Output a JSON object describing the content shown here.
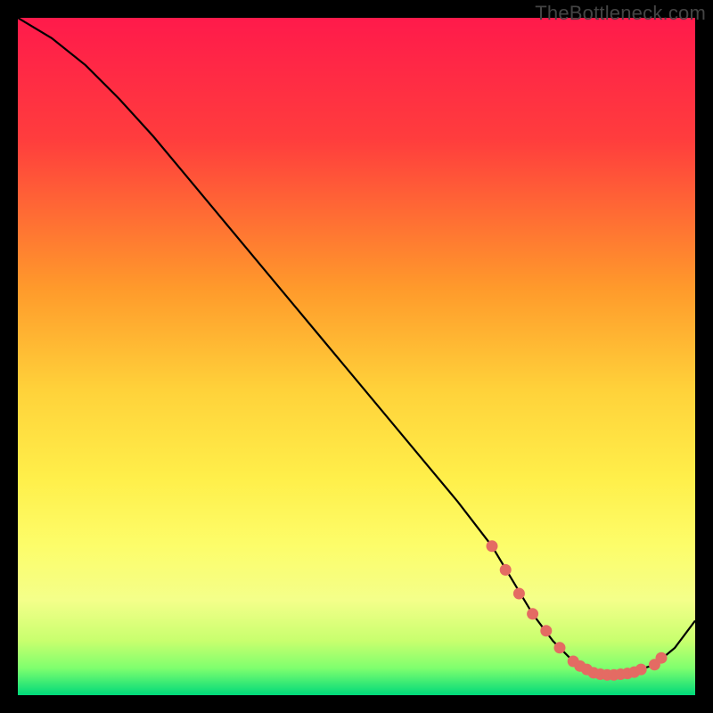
{
  "watermark": "TheBottleneck.com",
  "chart_data": {
    "type": "line",
    "title": "",
    "xlabel": "",
    "ylabel": "",
    "xlim": [
      0,
      100
    ],
    "ylim": [
      0,
      100
    ],
    "grid": false,
    "legend": false,
    "background_gradient": [
      {
        "stop": 0.0,
        "color": "#ff1a4b"
      },
      {
        "stop": 0.18,
        "color": "#ff3d3d"
      },
      {
        "stop": 0.4,
        "color": "#ff9a2b"
      },
      {
        "stop": 0.55,
        "color": "#ffd23a"
      },
      {
        "stop": 0.68,
        "color": "#ffef4a"
      },
      {
        "stop": 0.78,
        "color": "#fdfd6a"
      },
      {
        "stop": 0.86,
        "color": "#f4ff8a"
      },
      {
        "stop": 0.92,
        "color": "#c8ff6e"
      },
      {
        "stop": 0.96,
        "color": "#7fff6e"
      },
      {
        "stop": 1.0,
        "color": "#00d97a"
      }
    ],
    "series": [
      {
        "name": "bottleneck-curve",
        "color": "#000000",
        "x": [
          0,
          5,
          10,
          15,
          20,
          25,
          30,
          35,
          40,
          45,
          50,
          55,
          60,
          65,
          70,
          73,
          76,
          79,
          82,
          85,
          88,
          91,
          94,
          97,
          100
        ],
        "y": [
          100,
          97,
          93,
          88,
          82.5,
          76.5,
          70.5,
          64.5,
          58.5,
          52.5,
          46.5,
          40.5,
          34.5,
          28.5,
          22,
          17,
          12,
          8,
          5,
          3,
          3,
          3.5,
          4.5,
          7,
          11
        ]
      }
    ],
    "highlight_points": {
      "name": "optimal-range-dots",
      "color": "#e46b63",
      "x": [
        70,
        72,
        74,
        76,
        78,
        80,
        82,
        83,
        84,
        85,
        86,
        87,
        88,
        89,
        90,
        91,
        92,
        94,
        95
      ],
      "y": [
        22,
        18.5,
        15,
        12,
        9.5,
        7,
        5,
        4.3,
        3.8,
        3.3,
        3.1,
        3,
        3,
        3.1,
        3.2,
        3.4,
        3.8,
        4.5,
        5.5
      ]
    }
  }
}
